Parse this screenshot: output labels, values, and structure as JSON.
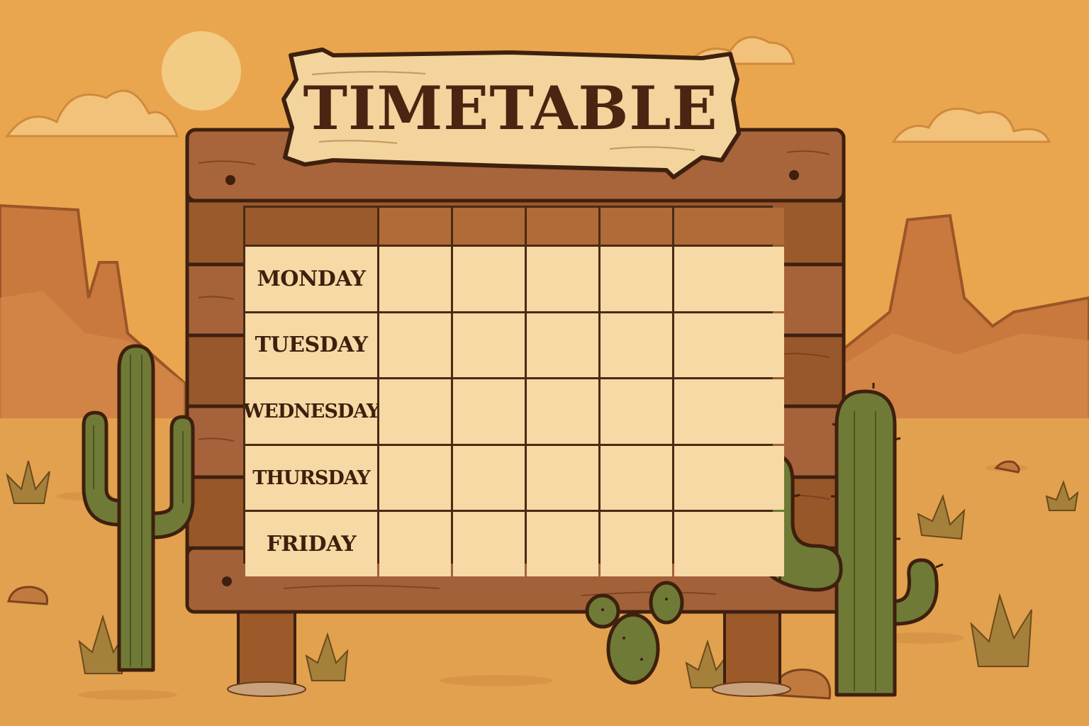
{
  "title": "TIMETABLE",
  "days": [
    "MONDAY",
    "TUESDAY",
    "WEDNESDAY",
    "THURSDAY",
    "FRIDAY"
  ],
  "slot_columns": 5,
  "colors": {
    "sky": "#e9a24c",
    "sand": "#e2a14e",
    "wood": "#9a5a2c",
    "wood_dark": "#6e3b1a",
    "paper": "#f6d9a4",
    "ink": "#3e200e",
    "cactus": "#6f7a36"
  }
}
